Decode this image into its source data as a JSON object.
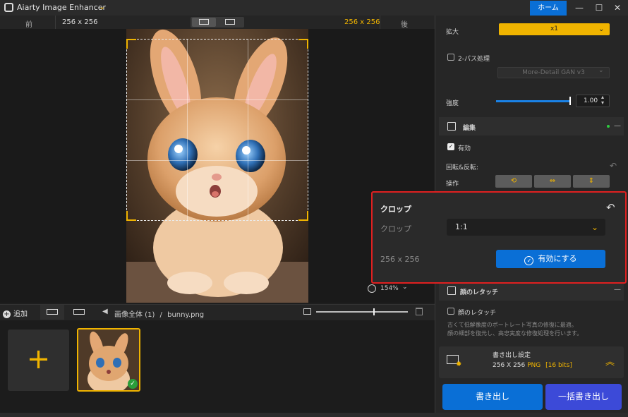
{
  "app": {
    "title": "Aiarty Image Enhancer",
    "home_label": "ホーム",
    "minimize": "—",
    "maximize": "☐",
    "close": "✕"
  },
  "compare": {
    "before_label": "前",
    "before_size": "256 x 256",
    "after_size": "256 x 256",
    "after_label": "後"
  },
  "preview": {
    "zoom": "154%"
  },
  "toolbar": {
    "add_label": "追加",
    "breadcrumb_all": "画像全体 (1)",
    "breadcrumb_sep": "/",
    "breadcrumb_file": "bunny.png"
  },
  "settings": {
    "scale_label": "拡大",
    "scale_value": "x1",
    "two_pass_label": "2-パス処理",
    "model_value": "More-Detail GAN  v3",
    "strength_label": "強度",
    "strength_value": "1.00",
    "strength_fraction": 1.0
  },
  "edit": {
    "section_title": "編集",
    "enabled_label": "有効",
    "rotate_label": "回転&反転:",
    "operation_label": "操作"
  },
  "face": {
    "section_title": "顔のレタッチ",
    "checkbox_label": "顔のレタッチ",
    "desc_line1": "古くて低解像度のポートレート写真の修復に最適。",
    "desc_line2": "顔の細部を復元し、高忠実度な修復処理を行います。"
  },
  "export": {
    "title": "書き出し設定",
    "size": "256 X 256",
    "format": "PNG",
    "bits": "[16 bits]",
    "export_label": "書き出し",
    "batch_label": "一括書き出し"
  },
  "crop": {
    "title": "クロップ",
    "field_label": "クロップ",
    "ratio_value": "1:1",
    "size_text": "256 x 256",
    "apply_label": "有効にする"
  },
  "colors": {
    "accent": "#f0b400",
    "blue": "#0a6fd6",
    "highlight": "#e02020"
  }
}
